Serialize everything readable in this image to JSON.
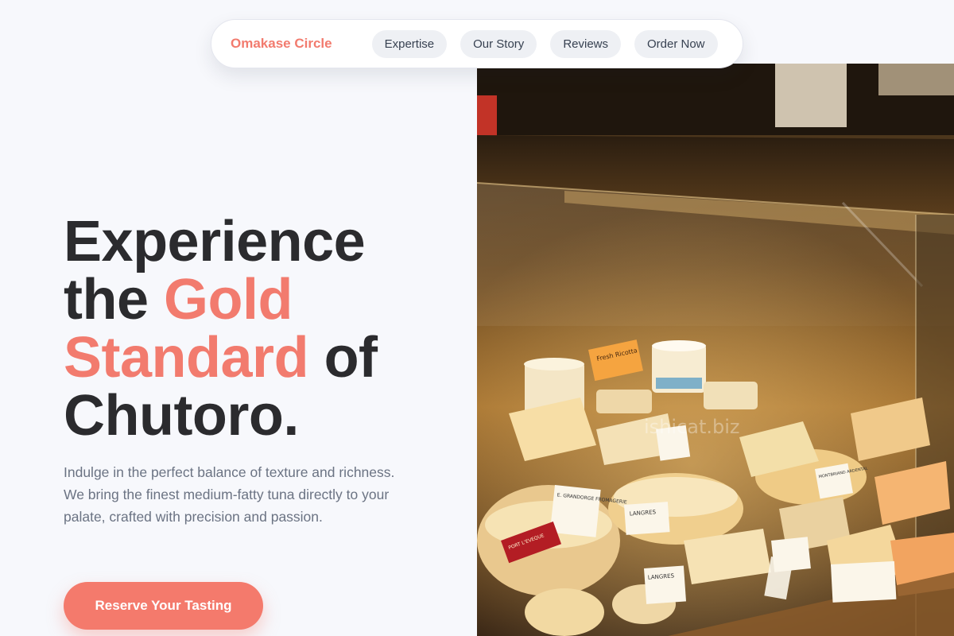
{
  "brand": {
    "name": "Omakase Circle"
  },
  "nav": {
    "links": [
      {
        "label": "Expertise"
      },
      {
        "label": "Our Story"
      },
      {
        "label": "Reviews"
      },
      {
        "label": "Order Now"
      }
    ]
  },
  "hero": {
    "title": {
      "line1": "Experience",
      "the": "the",
      "accent_gold": "Gold",
      "accent_standard": "Standard",
      "of": "of",
      "line4": "Chutoro."
    },
    "description": "Indulge in the perfect balance of texture and richness. We bring the finest medium-fatty tuna directly to your palate, crafted with precision and passion.",
    "cta_label": "Reserve Your Tasting",
    "image": {
      "subject": "cheese display case",
      "watermark": "ishicat.biz",
      "labels": {
        "fresh": "Fresh Ricotta",
        "frommagerie": "E. GRANDORGE FROMAGERIE",
        "langres": "LANGRES",
        "langres2": "LANGRES",
        "right": "MONTBRIAND ARDENTAL",
        "small": "PORT L'EVEQUE"
      }
    }
  },
  "colors": {
    "accent": "#f27b6e",
    "cta": "#f47a6c",
    "heading": "#2b2b2e",
    "body_text": "#6b7383",
    "background": "#f7f8fc"
  }
}
